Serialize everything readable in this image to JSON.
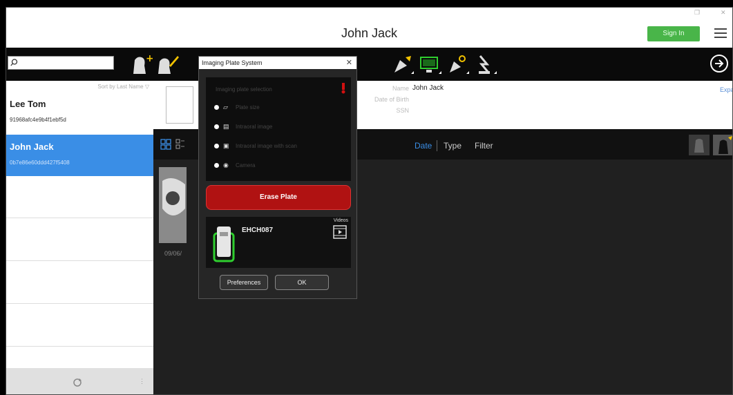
{
  "app": {
    "title": "John Jack",
    "signin_label": "Sign In"
  },
  "search": {
    "placeholder": ""
  },
  "sidebar": {
    "sort_label": "Sort by Last Name ▽",
    "patients": [
      {
        "name": "Lee Tom",
        "id": "91968afc4e9b4f1ebf5d"
      },
      {
        "name": "John Jack",
        "id": "0b7e86e60ddd427f5408"
      }
    ]
  },
  "patient_info": {
    "name_label": "Name",
    "name_value": "John Jack",
    "dob_label": "Date of Birth",
    "ssn_label": "SSN",
    "expand_label": "Expand"
  },
  "filterbar": {
    "date_label": "Date",
    "type_label": "Type",
    "filter_label": "Filter"
  },
  "thumbnail": {
    "date": "09/06/"
  },
  "dialog": {
    "title": "Imaging Plate System",
    "close_glyph": "✕",
    "options_heading": "Imaging plate selection",
    "options": [
      {
        "text": "Plate size"
      },
      {
        "text": "Intraoral image"
      },
      {
        "text": "Intraoral image with scan"
      },
      {
        "text": "Camera"
      }
    ],
    "erase_label": "Erase Plate",
    "device_name": "EHCH087",
    "videos_label": "Videos",
    "preferences_label": "Preferences",
    "ok_label": "OK"
  },
  "colors": {
    "accent_blue": "#3a8ee6",
    "sign_in_green": "#49b549",
    "erase_red": "#b01212",
    "device_green": "#2fcf2f"
  }
}
